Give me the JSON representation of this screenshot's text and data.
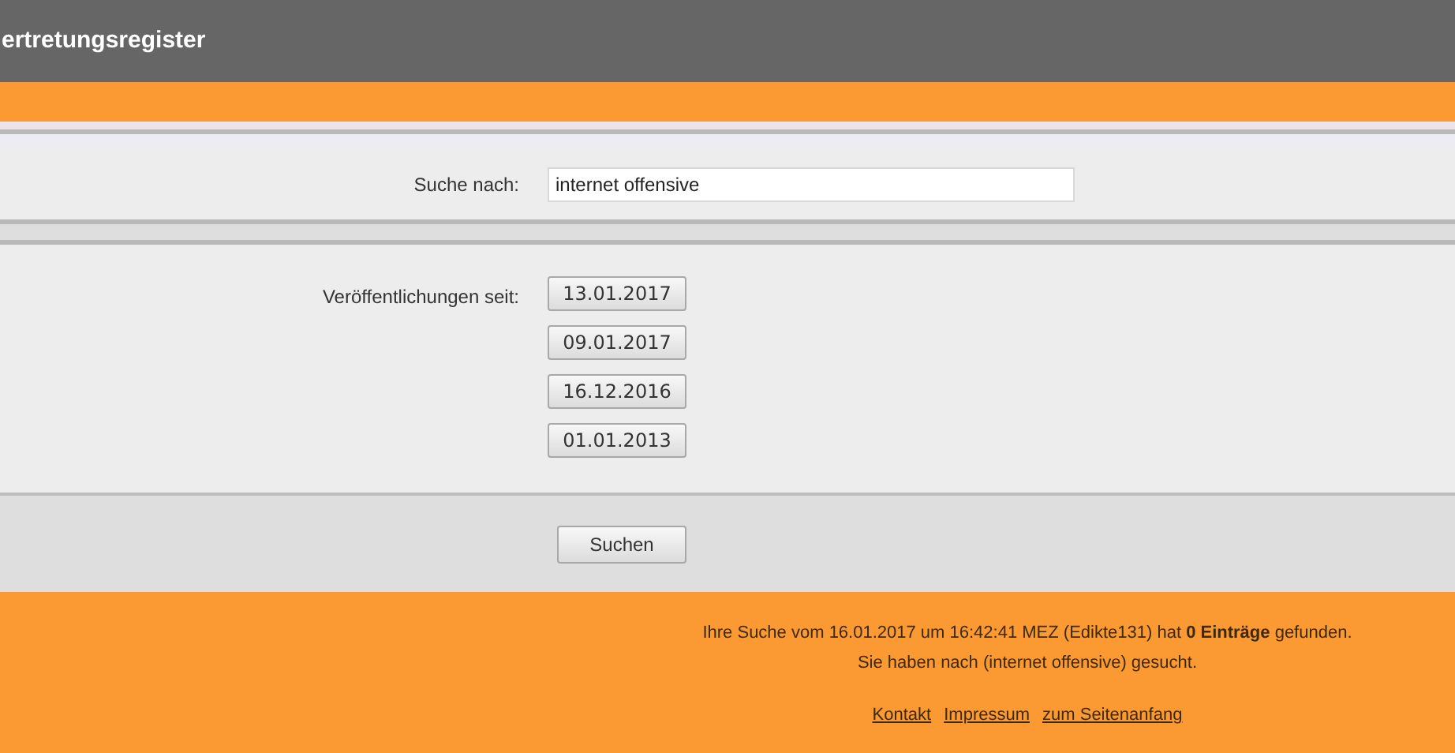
{
  "header": {
    "title": "ertretungsregister"
  },
  "search": {
    "label": "Suche nach:",
    "value": "internet offensive"
  },
  "publications": {
    "label": "Veröffentlichungen seit:",
    "dates": [
      "13.01.2017",
      "09.01.2017",
      "16.12.2016",
      "01.01.2013"
    ]
  },
  "submit": "Suchen",
  "result": {
    "line_1": "Ihre Suche vom 16.01.2017 um 16:42:41 MEZ (Edikte131) hat **0 Einträge** gefunden.",
    "line_2": "Sie haben nach (internet offensive) gesucht."
  },
  "footer_links": [
    "Kontakt",
    "Impressum",
    "zum Seitenanfang"
  ]
}
